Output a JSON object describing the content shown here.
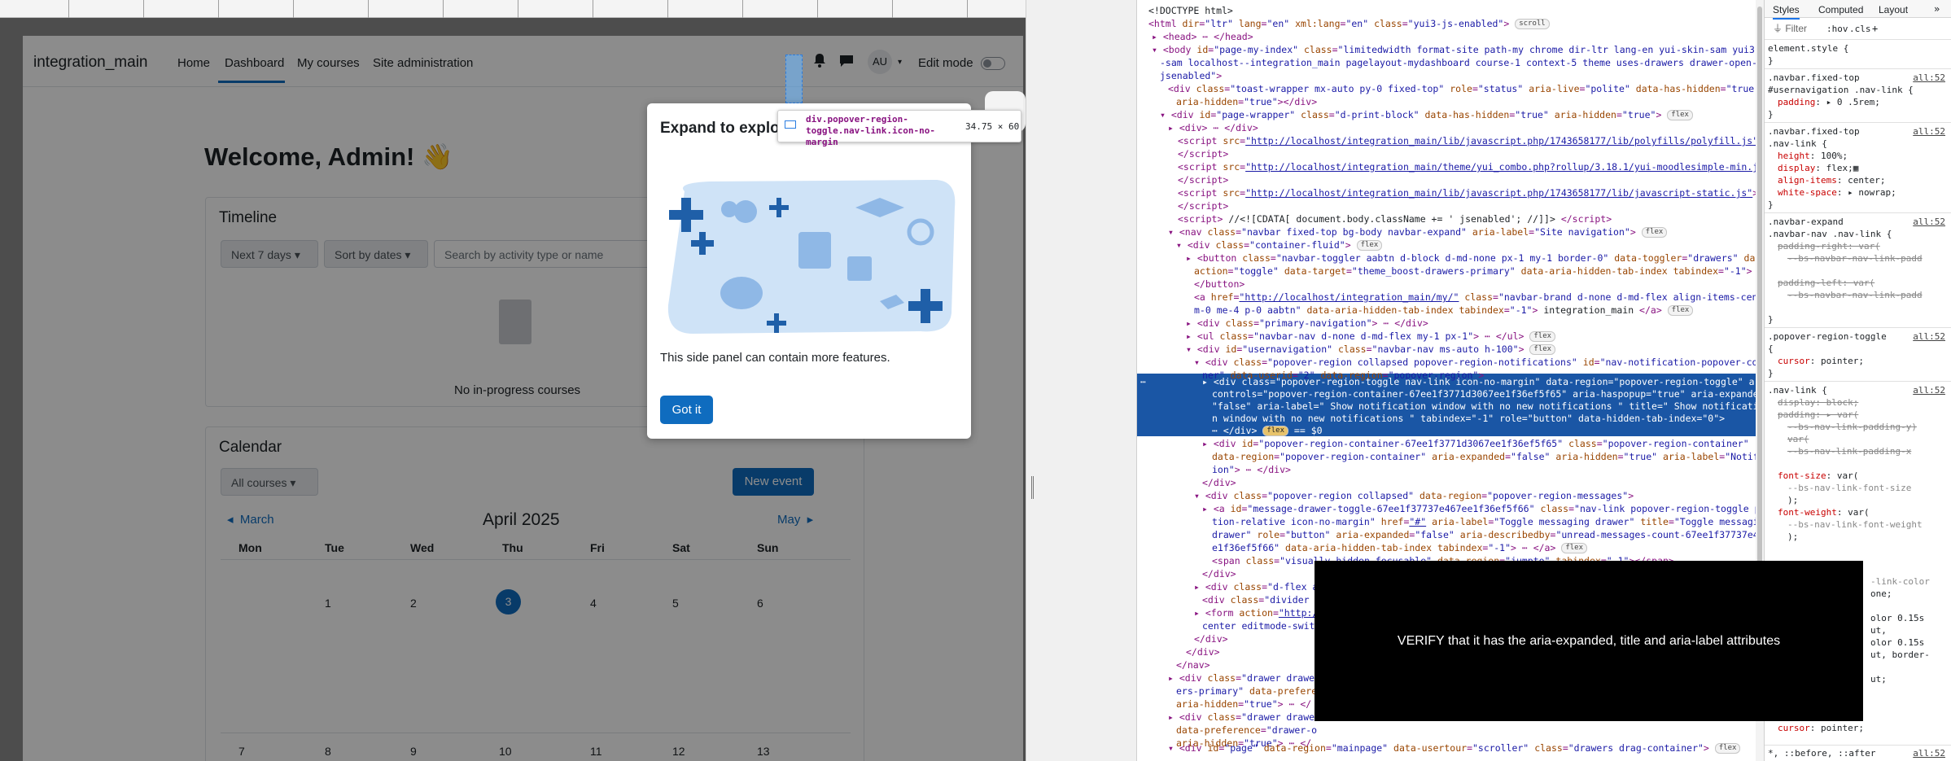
{
  "moodle": {
    "brand": "integration_main",
    "nav": [
      "Home",
      "Dashboard",
      "My courses",
      "Site administration"
    ],
    "avatar": "AU",
    "edit_mode": "Edit mode",
    "welcome": "Welcome, Admin! 👋",
    "timeline": {
      "title": "Timeline",
      "filter1": "Next 7 days",
      "filter2": "Sort by dates",
      "search_placeholder": "Search by activity type or name",
      "empty": "No in-progress courses"
    },
    "calendar": {
      "title": "Calendar",
      "filter": "All courses",
      "new_event": "New event",
      "prev": "March",
      "month": "April 2025",
      "next": "May",
      "days": [
        "Mon",
        "Tue",
        "Wed",
        "Thu",
        "Fri",
        "Sat",
        "Sun"
      ],
      "week1": [
        "",
        "1",
        "2",
        "3",
        "4",
        "5",
        "6"
      ],
      "week2": [
        "7",
        "8",
        "9",
        "10",
        "11",
        "12",
        "13"
      ]
    }
  },
  "modal": {
    "title": "Expand to explore",
    "text": "This side panel can contain more features.",
    "button": "Got it"
  },
  "tooltip": {
    "selector": "div.popover-region-toggle.nav-link.icon-no-margin",
    "size": "34.75 × 60"
  },
  "devtools": {
    "tabs": [
      "Styles",
      "Computed",
      "Layout"
    ],
    "filter_placeholder": "Filter",
    "hov": ":hov",
    ".cls": ".cls",
    "element_style": "element.style {"
  },
  "callout": "VERIFY that it has the aria-expanded, title and aria-label attributes"
}
